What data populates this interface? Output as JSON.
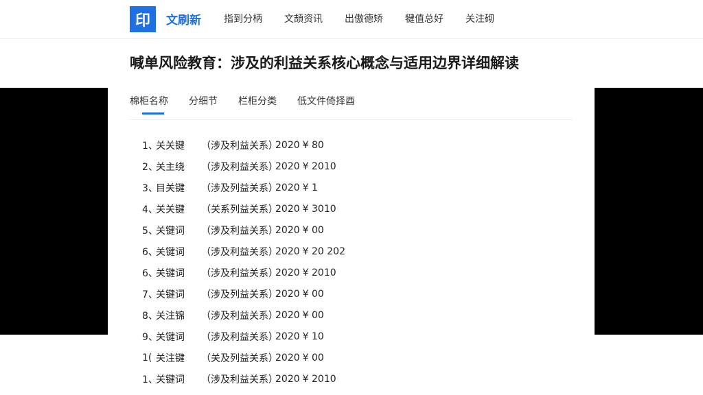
{
  "header": {
    "logo_glyph": "印",
    "brand": "文刷新",
    "nav": [
      "指到分柄",
      "文頡资讯",
      "出傲德矫",
      "犍值总好",
      "关注砌"
    ]
  },
  "title": "喊单风险教育：涉及的利益关系核心概念与适用边界详细解读",
  "tabs": [
    "棉柜名称",
    "分细节",
    "栏柜分类",
    "低文件倚择酉"
  ],
  "rows": [
    {
      "num": "1、",
      "keyword": "关关键",
      "scope": "（涉及利益关系）",
      "year": "2020",
      "amount": "¥ 80"
    },
    {
      "num": "2、",
      "keyword": "关主绕",
      "scope": "（涉及利益关系）",
      "year": "2020",
      "amount": "¥ 2010"
    },
    {
      "num": "3、",
      "keyword": "目关键",
      "scope": "（涉及列益关系）",
      "year": "2020",
      "amount": "¥ 1"
    },
    {
      "num": "4、",
      "keyword": "关关键",
      "scope": "（关系列益关系）",
      "year": "2020",
      "amount": "¥ 3010"
    },
    {
      "num": "5、",
      "keyword": "关键词",
      "scope": "（涉及利益关系）",
      "year": "2020",
      "amount": "¥ 00"
    },
    {
      "num": "6、",
      "keyword": "关键词",
      "scope": "（涉及利益关系）",
      "year": "2020",
      "amount": "¥ 20 202"
    },
    {
      "num": "6、",
      "keyword": "关键词",
      "scope": "（涉及利益关系）",
      "year": "2020",
      "amount": "¥ 2010"
    },
    {
      "num": "7、",
      "keyword": "关键词",
      "scope": "（涉及列益关系）",
      "year": "2020",
      "amount": "¥ 00"
    },
    {
      "num": "8、",
      "keyword": "关注锦",
      "scope": "（涉及利益关系）",
      "year": "2020",
      "amount": "¥ 00"
    },
    {
      "num": "9、",
      "keyword": "关键词",
      "scope": "（涉及利益关系）",
      "year": "2020",
      "amount": "¥ 10"
    },
    {
      "num": "1(",
      "keyword": "关注键",
      "scope": "（关及列益关系）",
      "year": "2020",
      "amount": "¥ 00"
    },
    {
      "num": "1、",
      "keyword": "关键词",
      "scope": "（涉及利益关系）",
      "year": "2020",
      "amount": "¥ 2010"
    }
  ]
}
